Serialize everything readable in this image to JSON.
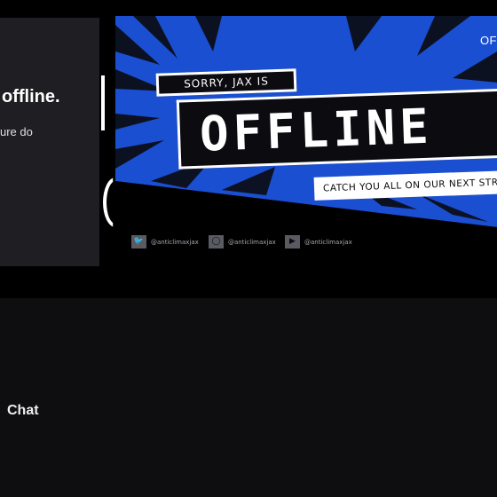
{
  "channel": {
    "status_title": "offline.",
    "status_subtitle": "ure do",
    "corner_text": "OF"
  },
  "banner": {
    "sorry_text": "SORRY, JAX IS",
    "offline_text": "OFFLINE",
    "catch_text": "CATCH YOU ALL ON OUR NEXT STREA",
    "socials": [
      {
        "icon": "twitter-icon",
        "handle": "@anticlimaxjax"
      },
      {
        "icon": "instagram-icon",
        "handle": "@anticlimaxjax"
      },
      {
        "icon": "youtube-icon",
        "handle": "@anticlimaxjax"
      }
    ],
    "colors": {
      "blue": "#1a4fd1",
      "dark": "#0b0b10",
      "white": "#ffffff"
    }
  },
  "tabs": {
    "chat_label": "Chat"
  },
  "colors": {
    "page_bg": "#0e0e10",
    "card_bg": "#1f1f23"
  }
}
